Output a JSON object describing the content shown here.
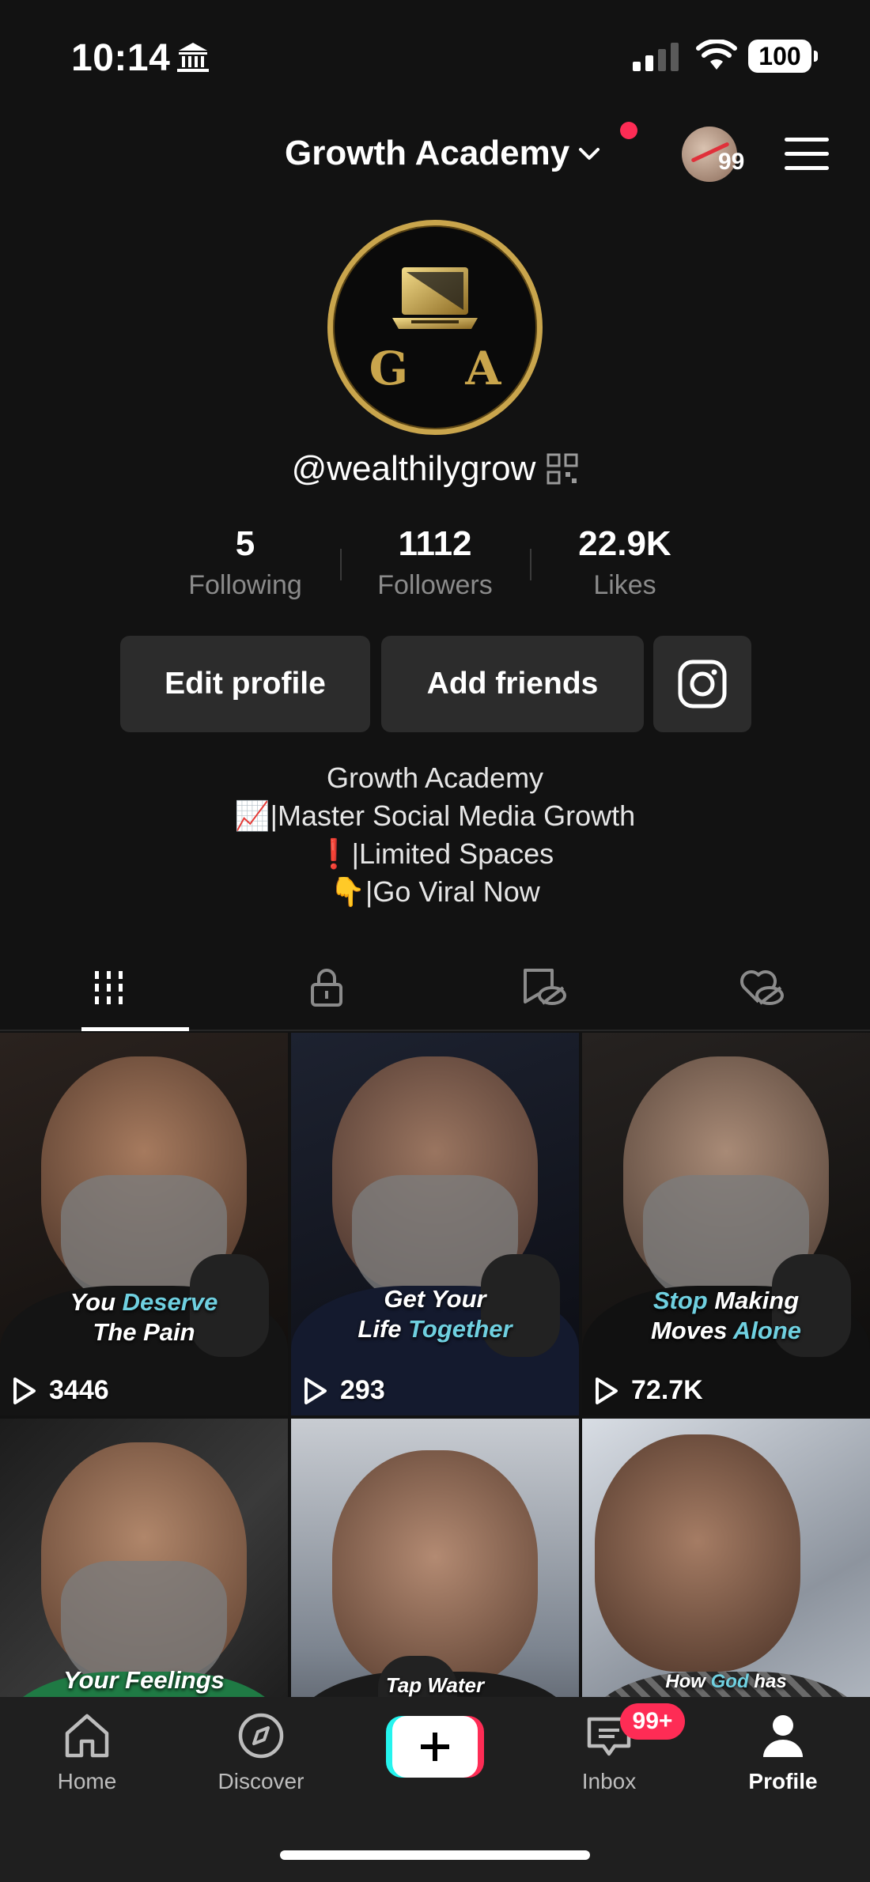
{
  "status_bar": {
    "time": "10:14",
    "battery": "100"
  },
  "header": {
    "account_name": "Growth Academy",
    "avatar_count": "99"
  },
  "profile": {
    "logo_text": "G A",
    "handle": "@wealthilygrow",
    "stats": [
      {
        "value": "5",
        "label": "Following"
      },
      {
        "value": "1112",
        "label": "Followers"
      },
      {
        "value": "22.9K",
        "label": "Likes"
      }
    ],
    "buttons": {
      "edit": "Edit profile",
      "add_friends": "Add friends"
    },
    "bio": [
      "Growth Academy",
      "📈|Master Social Media Growth",
      "❗️|Limited Spaces",
      "👇|Go Viral Now"
    ]
  },
  "tabs": [
    "videos",
    "private",
    "reposts",
    "liked"
  ],
  "videos": [
    {
      "caption_a": "You ",
      "caption_hl": "Deserve",
      "caption_b": "The Pain",
      "views": "3446"
    },
    {
      "caption_a": "Get Your",
      "caption_b": "Life ",
      "caption_hl": "Together",
      "views": "293"
    },
    {
      "caption_hl": "Stop",
      "caption_a": " Making",
      "caption_b": "Moves ",
      "caption_hl2": "Alone",
      "views": "72.7K"
    },
    {
      "caption": "Your Feelings"
    },
    {
      "caption": "Tap Water"
    },
    {
      "caption_a": "How ",
      "caption_hl": "God",
      "caption_b": " has"
    }
  ],
  "bottom_nav": {
    "home": "Home",
    "discover": "Discover",
    "inbox": "Inbox",
    "inbox_badge": "99+",
    "profile": "Profile"
  },
  "colors": {
    "accent": "#fe2c55",
    "cyan": "#25f4ee",
    "gold": "#c9a54c",
    "caption_highlight": "#6fd0e0"
  }
}
